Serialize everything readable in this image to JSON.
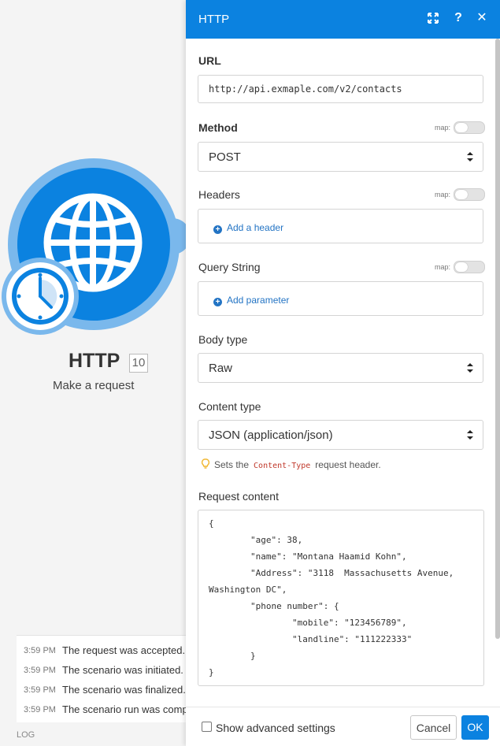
{
  "module": {
    "title": "HTTP",
    "badge": "10",
    "subtitle": "Make a request",
    "icons": [
      "globe-icon",
      "clock-icon"
    ]
  },
  "log": {
    "label": "LOG",
    "rows": [
      {
        "time": "3:59 PM",
        "message": "The request was accepted."
      },
      {
        "time": "3:59 PM",
        "message": "The scenario was initiated."
      },
      {
        "time": "3:59 PM",
        "message": "The scenario was finalized."
      },
      {
        "time": "3:59 PM",
        "message": "The scenario run was completed."
      }
    ]
  },
  "panel": {
    "title": "HTTP",
    "header_icons": [
      "expand-icon",
      "help-icon",
      "close-icon"
    ],
    "url": {
      "label": "URL",
      "value": "http://api.exmaple.com/v2/contacts"
    },
    "method": {
      "label": "Method",
      "map_label": "map:",
      "value": "POST"
    },
    "headers": {
      "label": "Headers",
      "map_label": "map:",
      "add_label": "Add a header"
    },
    "query_string": {
      "label": "Query String",
      "map_label": "map:",
      "add_label": "Add parameter"
    },
    "body_type": {
      "label": "Body type",
      "value": "Raw"
    },
    "content_type": {
      "label": "Content type",
      "value": "JSON (application/json)",
      "hint_before": "Sets the",
      "hint_code": "Content-Type",
      "hint_after": "request header."
    },
    "request_content": {
      "label": "Request content",
      "lines": [
        "{",
        "        \"age\": 38,",
        "        \"name\": \"Montana Haamid Kohn\",",
        "        \"Address\": \"3118  Massachusetts Avenue,",
        "Washington DC\",",
        "        \"phone number\": {",
        "                \"mobile\": \"123456789\",",
        "                \"landline\": \"111222333\"",
        "        }",
        "}"
      ]
    }
  },
  "footer": {
    "advanced_label": "Show advanced settings",
    "cancel_label": "Cancel",
    "ok_label": "OK"
  },
  "colors": {
    "accent": "#0b82e0",
    "module_ring": "#7ab8ec",
    "link": "#2374c4"
  }
}
